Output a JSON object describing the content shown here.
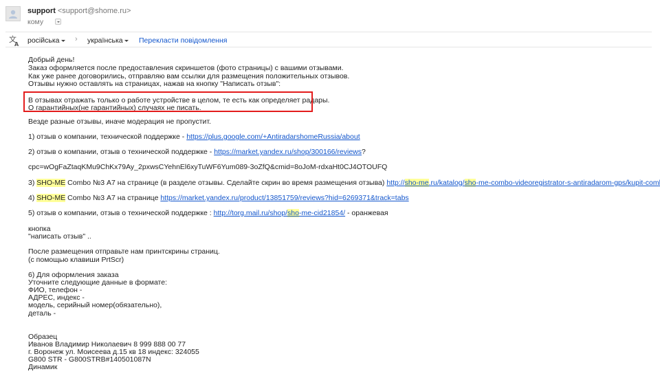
{
  "header": {
    "sender_name": "support",
    "sender_email": "<support@shome.ru>",
    "to_label": "кому"
  },
  "translation_bar": {
    "source_lang": "російська",
    "target_lang": "українська",
    "arrow": "›",
    "translate_link": "Перекласти повідомлення"
  },
  "message": {
    "greeting": "Добрый день!",
    "intro_1": "Заказ оформляется после предоставления скриншетов (фото страницы) с вашими отзывами.",
    "intro_2": "Как уже ранее договорились, отправляю вам ссылки для размещения положительных отзывов.",
    "intro_3": "Отзывы нужно оставлять на страницах,  нажав на кнопку \"Написать отзыв\":",
    "boxed_1": "В отзывах отражать только о работе устройстве в целом, те есть как определяет радары.",
    "boxed_2": "О гарантийных(не гарантийных) случаях не писать.",
    "moderation": "Везде разные отзывы, иначе модерация не пропустит.",
    "item1_text": "1) отзыв о компании, технической поддержке - ",
    "item1_link": "https://plus.google.com/+AntiradarshomeRussia/about",
    "item2_text": "2) отзыв о компании, отзыв о технической поддержке - ",
    "item2_link": "https://market.yandex.ru/shop/300166/reviews",
    "item2_tail": "?",
    "item2_query": "cpc=wOgFaZtaqKMu9ChKx79Ay_2pxwsCYehnEl6xyTuWF6Yum089-3oZfQ&cmid=8oJoM-rdxaHt0CJ4OTOUFQ",
    "item3_num": "3) ",
    "item3_brand": "SHO-ME",
    "item3_text": " Combo №3 А7 на странице (в разделе отзывы. Сделайте скрин во время размещения отзыва) ",
    "item3_link_a": "http://",
    "item3_link_b": "sho-me",
    "item3_link_c": ".ru/katalog/",
    "item3_link_d": "sho",
    "item3_link_e": "-me-combo-videoregistrator-s-antiradarom-gps/kupit-combo-3-a7",
    "item4_num": "4) ",
    "item4_brand": "SHO-ME",
    "item4_text": " Combo №3 А7 на странице ",
    "item4_link": "https://market.yandex.ru/product/13851759/reviews?hid=6269371&track=tabs",
    "item5_text": "5) отзыв о компании, отзыв о технической поддержке : ",
    "item5_link_a": "http://torg.mail.ru/shop/",
    "item5_link_b": "sho",
    "item5_link_c": "-me-cid21854/",
    "item5_tail": "  - оранжевая",
    "button_1": "кнопка",
    "button_2": "\"написать отзыв\" ..",
    "after_1": "После размещения отправьте нам принтскрины страниц.",
    "after_2": "(с помощью клавиши PrtScr)",
    "order_1": "6) Для оформления заказа",
    "order_2": "Уточните следующие данные в формате:",
    "order_3": "ФИО, телефон -",
    "order_4": "АДРЕС, индекс -",
    "order_5": "модель, серийный номер(обязательно),",
    "order_6": "деталь -",
    "sample_title": "Образец",
    "sample_1": "Иванов Владимир Николаевич 8 999 888 00 77",
    "sample_2": "г. Воронеж ул. Моисеева д.15 кв 18 индекс: 324055",
    "sample_3": "G800 STR - G800STRB#140501087N",
    "sample_4": "Динамик"
  },
  "colors": {
    "link": "#1155cc",
    "highlight": "#ffff99",
    "box_border": "#e31b1b"
  }
}
